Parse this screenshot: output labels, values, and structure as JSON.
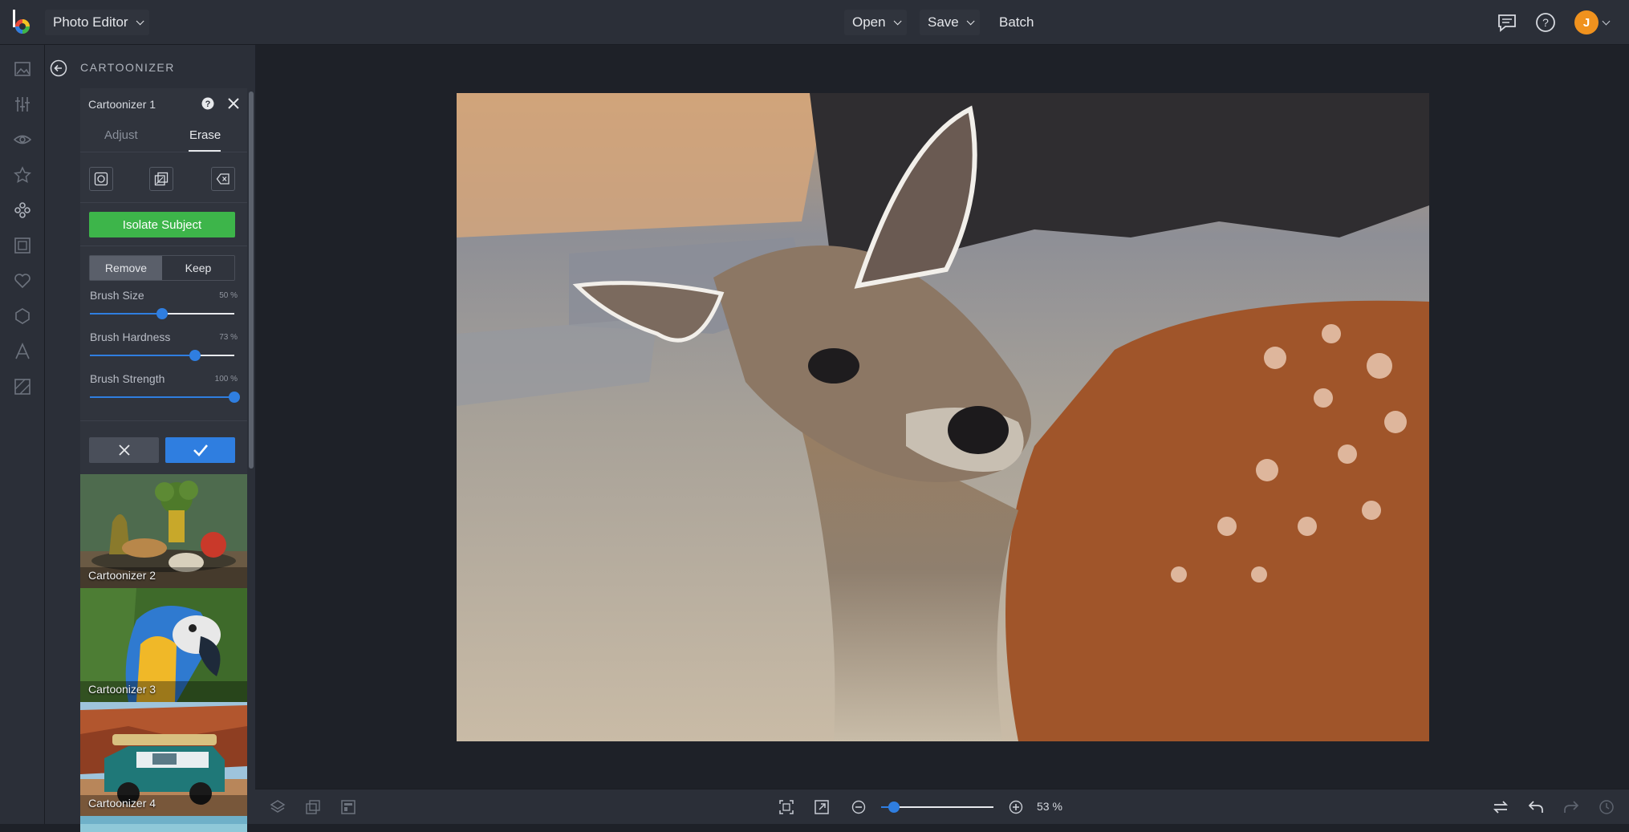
{
  "topbar": {
    "app_name": "Photo Editor",
    "open_label": "Open",
    "save_label": "Save",
    "batch_label": "Batch",
    "avatar_initial": "J"
  },
  "rail": {
    "items": [
      "image-icon",
      "sliders-icon",
      "eye-icon",
      "star-icon",
      "effects-icon",
      "frame-icon",
      "heart-icon",
      "shape-icon",
      "text-icon",
      "texture-icon"
    ]
  },
  "panel": {
    "title": "CARTOONIZER",
    "card": {
      "title": "Cartoonizer 1",
      "tabs": [
        "Adjust",
        "Erase"
      ],
      "active_tab": "Erase",
      "isolate_label": "Isolate Subject",
      "mode": {
        "remove": "Remove",
        "keep": "Keep",
        "active": "Remove"
      },
      "sliders": [
        {
          "label": "Brush Size",
          "value_text": "50 %",
          "value": 50
        },
        {
          "label": "Brush Hardness",
          "value_text": "73 %",
          "value": 73
        },
        {
          "label": "Brush Strength",
          "value_text": "100 %",
          "value": 100
        }
      ]
    },
    "presets": [
      {
        "label": "Cartoonizer 2"
      },
      {
        "label": "Cartoonizer 3"
      },
      {
        "label": "Cartoonizer 4"
      }
    ]
  },
  "bottombar": {
    "zoom_text": "53 %",
    "zoom_value": 53
  },
  "colors": {
    "accent": "#2f7ee0",
    "isolate": "#3db54a",
    "avatar": "#f0921e"
  }
}
